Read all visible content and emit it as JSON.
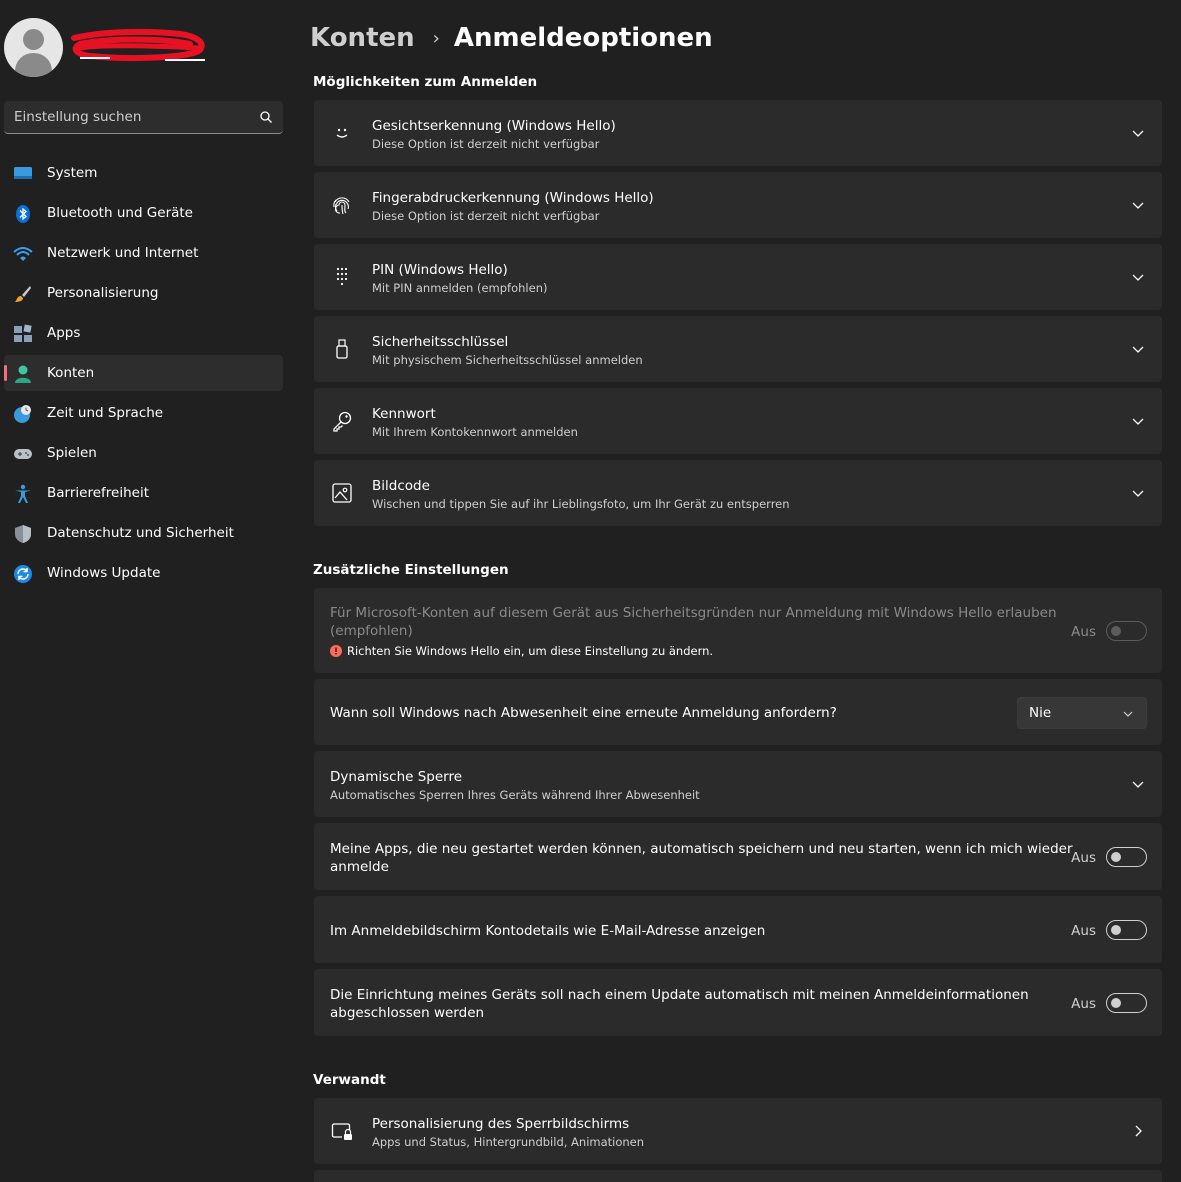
{
  "search": {
    "placeholder": "Einstellung suchen"
  },
  "sidebar": {
    "items": [
      {
        "label": "System",
        "icon": "system-icon"
      },
      {
        "label": "Bluetooth und Geräte",
        "icon": "bluetooth-icon"
      },
      {
        "label": "Netzwerk und Internet",
        "icon": "wifi-icon"
      },
      {
        "label": "Personalisierung",
        "icon": "brush-icon"
      },
      {
        "label": "Apps",
        "icon": "apps-icon"
      },
      {
        "label": "Konten",
        "icon": "account-icon",
        "active": true
      },
      {
        "label": "Zeit und Sprache",
        "icon": "globe-clock-icon"
      },
      {
        "label": "Spielen",
        "icon": "gamepad-icon"
      },
      {
        "label": "Barrierefreiheit",
        "icon": "accessibility-icon"
      },
      {
        "label": "Datenschutz und Sicherheit",
        "icon": "shield-icon"
      },
      {
        "label": "Windows Update",
        "icon": "update-icon"
      }
    ]
  },
  "header": {
    "parent": "Konten",
    "separator": "›",
    "current": "Anmeldeoptionen"
  },
  "sections": {
    "signin": "Möglichkeiten zum Anmelden",
    "additional": "Zusätzliche Einstellungen",
    "related": "Verwandt"
  },
  "signin_options": [
    {
      "title": "Gesichtserkennung (Windows Hello)",
      "subtitle": "Diese Option ist derzeit nicht verfügbar",
      "icon": "face-icon"
    },
    {
      "title": "Fingerabdruckerkennung (Windows Hello)",
      "subtitle": "Diese Option ist derzeit nicht verfügbar",
      "icon": "fingerprint-icon"
    },
    {
      "title": "PIN (Windows Hello)",
      "subtitle": "Mit PIN anmelden (empfohlen)",
      "icon": "keypad-icon"
    },
    {
      "title": "Sicherheitsschlüssel",
      "subtitle": "Mit physischem Sicherheitsschlüssel anmelden",
      "icon": "usb-key-icon"
    },
    {
      "title": "Kennwort",
      "subtitle": "Mit Ihrem Kontokennwort anmelden",
      "icon": "key-icon"
    },
    {
      "title": "Bildcode",
      "subtitle": "Wischen und tippen Sie auf ihr Lieblingsfoto, um Ihr Gerät zu entsperren",
      "icon": "picture-icon"
    }
  ],
  "additional": {
    "hello_only": {
      "line1": "Für Microsoft-Konten auf diesem Gerät aus Sicherheitsgründen nur Anmeldung mit Windows Hello erlauben",
      "line2": "(empfohlen)",
      "warning": "Richten Sie Windows Hello ein, um diese Einstellung zu ändern.",
      "state": "Aus",
      "enabled": false
    },
    "reauth": {
      "label": "Wann soll Windows nach Abwesenheit eine erneute Anmeldung anfordern?",
      "value": "Nie"
    },
    "dynamic_lock": {
      "title": "Dynamische Sperre",
      "subtitle": "Automatisches Sperren Ihres Geräts während Ihrer Abwesenheit"
    },
    "restart_apps": {
      "line1": "Meine Apps, die neu gestartet werden können, automatisch speichern und neu starten, wenn ich mich wieder",
      "line2": "anmelde",
      "state": "Aus"
    },
    "account_details": {
      "label": "Im Anmeldebildschirm Kontodetails wie E-Mail-Adresse anzeigen",
      "state": "Aus"
    },
    "auto_finish": {
      "line1": "Die Einrichtung meines Geräts soll nach einem Update automatisch mit meinen Anmeldeinformationen",
      "line2": "abgeschlossen werden",
      "state": "Aus"
    }
  },
  "related": [
    {
      "title": "Personalisierung des Sperrbildschirms",
      "subtitle": "Apps und Status, Hintergrundbild, Animationen",
      "icon": "lock-screen-icon"
    }
  ],
  "colors": {
    "background": "#202020",
    "card": "#2b2b2b",
    "accent_indicator": "#f1707b",
    "warning": "#ff6b5b",
    "redaction": "#e81123"
  }
}
